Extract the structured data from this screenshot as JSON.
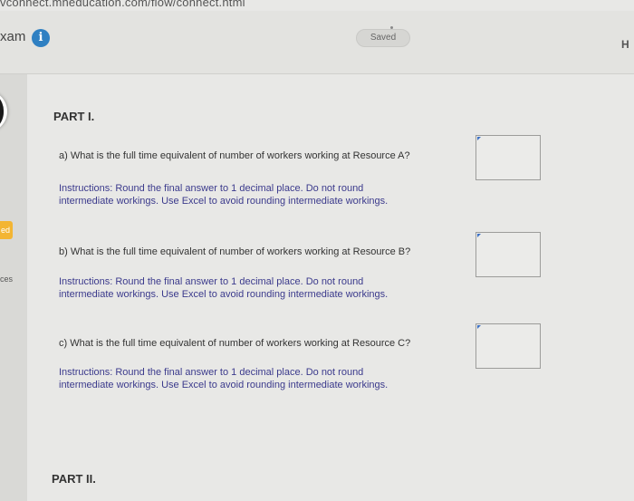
{
  "browser": {
    "url": "vconnect.mheducation.com/flow/connect.html"
  },
  "header": {
    "exam_label": "xam",
    "info_icon": "i",
    "saved_label": "Saved",
    "right_label": "H"
  },
  "sidebar": {
    "edge_label": "ed",
    "edge_label_2": "ces"
  },
  "part1": {
    "title": "PART I."
  },
  "questions": [
    {
      "text": "a) What is the full time equivalent of number of workers working at Resource A?",
      "instruction_line1": "Instructions: Round the final answer to 1 decimal place. Do not round",
      "instruction_line2": "intermediate workings. Use Excel to avoid rounding intermediate workings.",
      "answer": ""
    },
    {
      "text": "b) What is the full time equivalent of number of workers working at Resource B?",
      "instruction_line1": "Instructions: Round the final answer to 1 decimal place. Do not round",
      "instruction_line2": "intermediate workings. Use Excel to avoid rounding intermediate workings.",
      "answer": ""
    },
    {
      "text": "c) What is the full time equivalent of number of workers working at Resource C?",
      "instruction_line1": "Instructions: Round the final answer to 1 decimal place. Do not round",
      "instruction_line2": "intermediate workings. Use Excel to avoid rounding intermediate workings.",
      "answer": ""
    }
  ],
  "part2": {
    "title": "PART II."
  },
  "colors": {
    "instruction_text": "#3b3a8c",
    "info_icon_bg": "#2f80c2",
    "side_highlight": "#f3b533"
  }
}
